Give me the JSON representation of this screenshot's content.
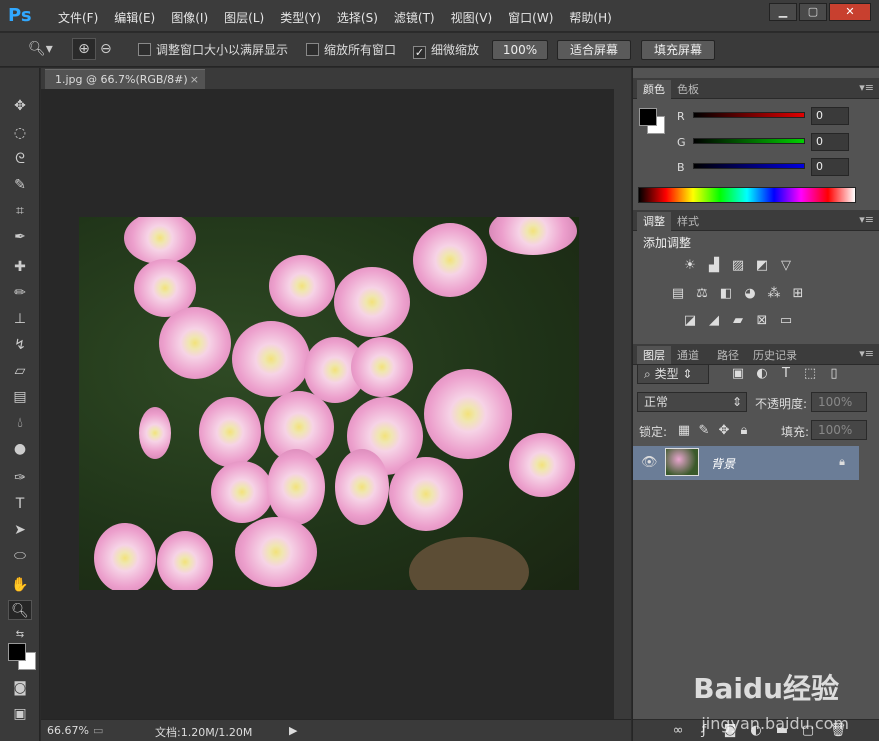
{
  "app": {
    "logo": "Ps"
  },
  "menu": [
    "文件(F)",
    "编辑(E)",
    "图像(I)",
    "图层(L)",
    "类型(Y)",
    "选择(S)",
    "滤镜(T)",
    "视图(V)",
    "窗口(W)",
    "帮助(H)"
  ],
  "window_controls": {
    "minimize": "▁",
    "restore": "▢",
    "close": "✕"
  },
  "options": {
    "resize_windows": "调整窗口大小以满屏显示",
    "zoom_all": "缩放所有窗口",
    "scrubby_zoom": "细微缩放",
    "scrubby_checked": true,
    "btn_100": "100%",
    "btn_fit": "适合屏幕",
    "btn_fill": "填充屏幕"
  },
  "document": {
    "tab_title": "1.jpg @ 66.7%(RGB/8#)",
    "close": "×"
  },
  "status": {
    "zoom": "66.67%",
    "doc_info": "文档:1.20M/1.20M"
  },
  "color_panel": {
    "tabs": [
      "颜色",
      "色板"
    ],
    "r_label": "R",
    "g_label": "G",
    "b_label": "B",
    "r_value": "0",
    "g_value": "0",
    "b_value": "0"
  },
  "adjust_panel": {
    "tabs": [
      "调整",
      "样式"
    ],
    "title": "添加调整"
  },
  "layers_panel": {
    "tabs": [
      "图层",
      "通道",
      "路径",
      "历史记录"
    ],
    "filter_kind": "类型",
    "blend_mode": "正常",
    "opacity_label": "不透明度:",
    "opacity_value": "100%",
    "lock_label": "锁定:",
    "fill_label": "填充:",
    "fill_value": "100%",
    "layer_name": "背景"
  },
  "watermark": {
    "brand": "Baidu经验",
    "url": "jingyan.baidu.com"
  },
  "colors": {
    "accent": "#31a8ff",
    "selected_layer": "#6b7d97",
    "bg_dark": "#282828"
  }
}
